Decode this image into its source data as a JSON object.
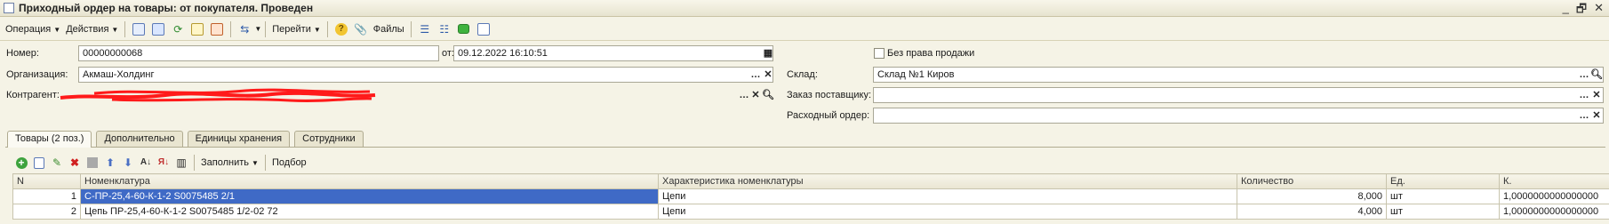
{
  "window": {
    "title": "Приходный ордер на товары: от покупателя. Проведен",
    "controls": [
      "_",
      "🗗",
      "✕"
    ]
  },
  "toolbar": {
    "operation_label": "Операция",
    "actions_label": "Действия",
    "goto_label": "Перейти",
    "files_label": "Файлы",
    "help_glyph": "?"
  },
  "form": {
    "number_label": "Номер:",
    "number_value": "00000000068",
    "date_label": "от:",
    "date_value": "09.12.2022 16:10:51",
    "no_sale_right_label": "Без права продажи",
    "organization_label": "Организация:",
    "organization_value": "Акмаш-Холдинг",
    "warehouse_label": "Склад:",
    "warehouse_value": "Склад №1 Киров",
    "counterparty_label": "Контрагент:",
    "counterparty_value": "",
    "supplier_order_label": "Заказ поставщику:",
    "supplier_order_value": "",
    "expense_order_label": "Расходный ордер:",
    "expense_order_value": ""
  },
  "tabs": [
    {
      "label": "Товары (2 поз.)"
    },
    {
      "label": "Дополнительно"
    },
    {
      "label": "Единицы хранения"
    },
    {
      "label": "Сотрудники"
    }
  ],
  "table_toolbar": {
    "fill_label": "Заполнить",
    "pick_label": "Подбор"
  },
  "table": {
    "columns": [
      "N",
      "Номенклатура",
      "Характеристика номенклатуры",
      "Количество",
      "Ед.",
      "К."
    ],
    "rows": [
      {
        "n": "1",
        "item": "С-ПР-25,4-60-К-1-2 S0075485 2/1",
        "characteristic": "Цепи",
        "qty": "8,000",
        "unit": "шт",
        "k": "1,0000000000000000"
      },
      {
        "n": "2",
        "item": "Цепь ПР-25,4-60-К-1-2 S0075485 1/2-02 72",
        "characteristic": "Цепи",
        "qty": "4,000",
        "unit": "шт",
        "k": "1,0000000000000000"
      }
    ]
  },
  "colors": {
    "background": "#f5f3e6",
    "selection": "#3f6ac6",
    "redaction": "#ff1a1a"
  }
}
